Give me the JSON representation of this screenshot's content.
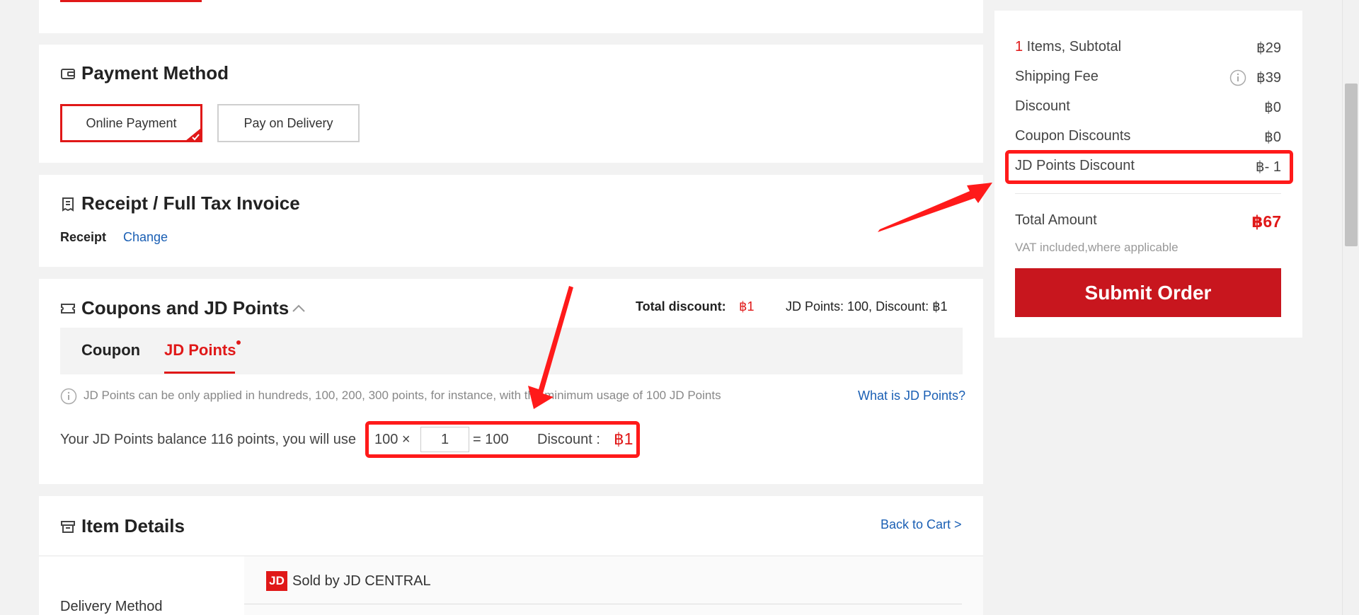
{
  "payment": {
    "title": "Payment Method",
    "options": [
      "Online Payment",
      "Pay on Delivery"
    ]
  },
  "receipt": {
    "title": "Receipt / Full Tax Invoice",
    "type_label": "Receipt",
    "change_link": "Change"
  },
  "coupons": {
    "title": "Coupons and JD Points",
    "total_discount_label": "Total discount:",
    "total_discount_value": "฿1",
    "points_summary": "JD Points: 100, Discount: ฿1",
    "tabs": [
      "Coupon",
      "JD Points"
    ],
    "active_tab": "JD Points",
    "info_text": "JD Points can be only applied in hundreds, 100, 200, 300 points, for instance, with the minimum usage of 100 JD Points",
    "what_is_link": "What is JD Points?",
    "balance_text": "Your JD Points balance 116 points, you will use",
    "multiplier": "100 ×",
    "quantity": "1",
    "equals": "= 100",
    "discount_label": "Discount :",
    "discount_value": "฿1"
  },
  "items": {
    "title": "Item Details",
    "back_link": "Back to Cart >",
    "delivery_label": "Delivery Method",
    "seller_badge": "JD",
    "seller_text": "Sold by JD CENTRAL"
  },
  "summary": {
    "items_count": "1",
    "items_label": " Items, Subtotal",
    "subtotal": "฿29",
    "shipping_label": "Shipping Fee",
    "shipping": "฿39",
    "discount_label": "Discount",
    "discount": "฿0",
    "coupon_label": "Coupon Discounts",
    "coupon": "฿0",
    "points_label": "JD Points Discount",
    "points": "฿- 1",
    "total_label": "Total Amount",
    "total": "฿67",
    "vat_note": "VAT included,where applicable",
    "submit_label": "Submit Order"
  },
  "colors": {
    "accent_red": "#e01818",
    "submit_red": "#c8161e",
    "link_blue": "#1a5fb4",
    "highlight_red": "#ff1a1a"
  }
}
